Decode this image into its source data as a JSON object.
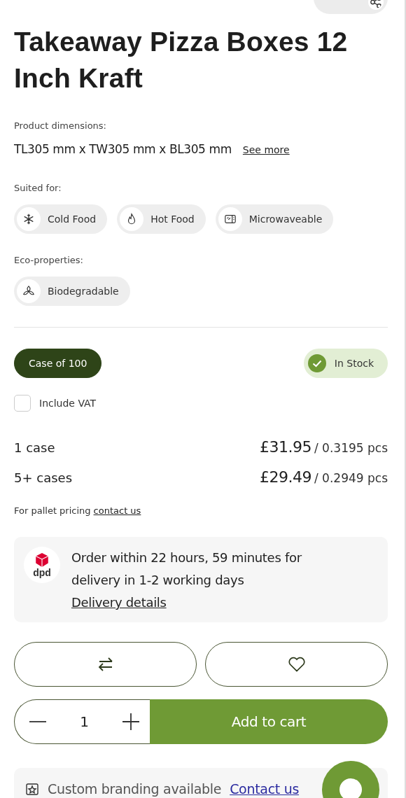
{
  "title": "Takeaway Pizza Boxes 12 Inch Kraft",
  "dimensions": {
    "label": "Product dimensions:",
    "value": "TL305 mm x TW305 mm x BL305 mm",
    "link": "See more"
  },
  "suited": {
    "label": "Suited for:",
    "tags": [
      {
        "kind": "snowflake",
        "text": "Cold Food"
      },
      {
        "kind": "flame",
        "text": "Hot Food"
      },
      {
        "kind": "microwave",
        "text": "Microwaveable"
      }
    ]
  },
  "eco": {
    "label": "Eco-properties:",
    "tags": [
      {
        "kind": "leaf",
        "text": "Biodegradable"
      }
    ]
  },
  "pack": {
    "label": "Case of 100",
    "selected": true
  },
  "stock": {
    "text": "In Stock",
    "in_stock": true
  },
  "vat": {
    "label": "Include VAT",
    "checked": false
  },
  "prices": [
    {
      "qty": "1 case",
      "price": "£31.95",
      "unit": "/ 0.3195 pcs"
    },
    {
      "qty": "5+ cases",
      "price": "£29.49",
      "unit": "/ 0.2949 pcs"
    }
  ],
  "pallet": {
    "text": "For pallet pricing",
    "link": "contact us"
  },
  "delivery": {
    "logo": "dpd",
    "text": "Order within 22 hours, 59 minutes for delivery in 1-2 working days",
    "link": "Delivery details"
  },
  "quantity": "1",
  "cart_button": "Add to cart",
  "branding": {
    "text": "Custom branding available",
    "link": "Contact us"
  }
}
